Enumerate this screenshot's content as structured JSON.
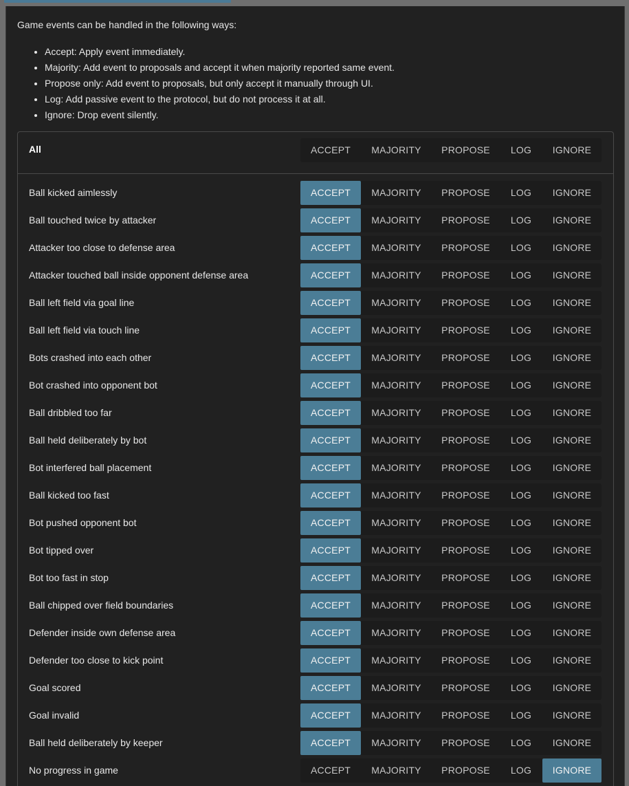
{
  "intro": {
    "text": "Game events can be handled in the following ways:",
    "items": [
      "Accept: Apply event immediately.",
      "Majority: Add event to proposals and accept it when majority reported same event.",
      "Propose only: Add event to proposals, but only accept it manually through UI.",
      "Log: Add passive event to the protocol, but do not process it at all.",
      "Ignore: Drop event silently."
    ]
  },
  "options": [
    "ACCEPT",
    "MAJORITY",
    "PROPOSE",
    "LOG",
    "IGNORE"
  ],
  "colors": {
    "active": "#4b7d96",
    "panel": "#212121",
    "group": "#1c1c1c"
  },
  "all": {
    "label": "All",
    "selected": ""
  },
  "events": [
    {
      "label": "Ball kicked aimlessly",
      "selected": "ACCEPT"
    },
    {
      "label": "Ball touched twice by attacker",
      "selected": "ACCEPT"
    },
    {
      "label": "Attacker too close to defense area",
      "selected": "ACCEPT"
    },
    {
      "label": "Attacker touched ball inside opponent defense area",
      "selected": "ACCEPT"
    },
    {
      "label": "Ball left field via goal line",
      "selected": "ACCEPT"
    },
    {
      "label": "Ball left field via touch line",
      "selected": "ACCEPT"
    },
    {
      "label": "Bots crashed into each other",
      "selected": "ACCEPT"
    },
    {
      "label": "Bot crashed into opponent bot",
      "selected": "ACCEPT"
    },
    {
      "label": "Ball dribbled too far",
      "selected": "ACCEPT"
    },
    {
      "label": "Ball held deliberately by bot",
      "selected": "ACCEPT"
    },
    {
      "label": "Bot interfered ball placement",
      "selected": "ACCEPT"
    },
    {
      "label": "Ball kicked too fast",
      "selected": "ACCEPT"
    },
    {
      "label": "Bot pushed opponent bot",
      "selected": "ACCEPT"
    },
    {
      "label": "Bot tipped over",
      "selected": "ACCEPT"
    },
    {
      "label": "Bot too fast in stop",
      "selected": "ACCEPT"
    },
    {
      "label": "Ball chipped over field boundaries",
      "selected": "ACCEPT"
    },
    {
      "label": "Defender inside own defense area",
      "selected": "ACCEPT"
    },
    {
      "label": "Defender too close to kick point",
      "selected": "ACCEPT"
    },
    {
      "label": "Goal scored",
      "selected": "ACCEPT"
    },
    {
      "label": "Goal invalid",
      "selected": "ACCEPT"
    },
    {
      "label": "Ball held deliberately by keeper",
      "selected": "ACCEPT"
    },
    {
      "label": "No progress in game",
      "selected": "IGNORE"
    }
  ]
}
